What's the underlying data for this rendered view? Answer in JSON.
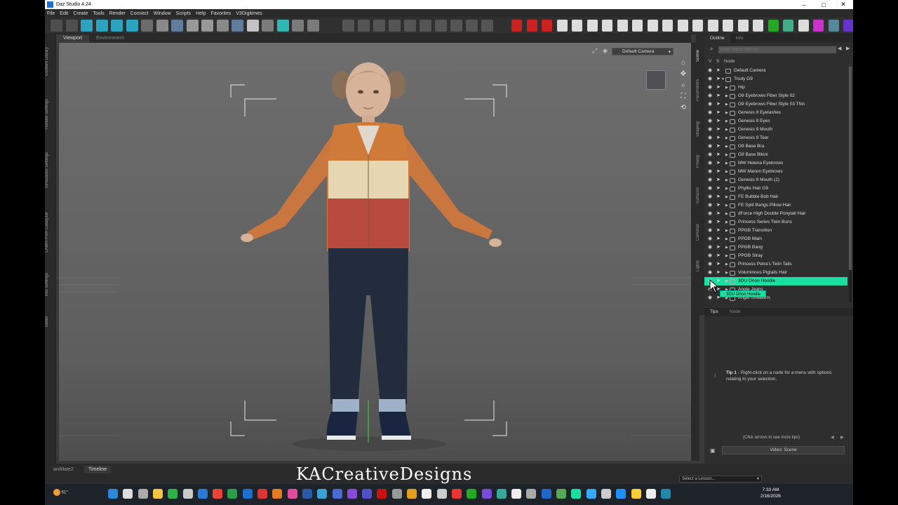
{
  "window": {
    "title": "Daz Studio 4.24"
  },
  "menu": [
    "File",
    "Edit",
    "Create",
    "Tools",
    "Render",
    "Connect",
    "Window",
    "Scripts",
    "Help",
    "Favorites",
    "V3Digitimes"
  ],
  "left_rail_tabs": [
    "Content Library",
    "Render Settings",
    "Simulation Settings",
    "LAMH Prim Catalyzer",
    "Tool Settings",
    "Tablet"
  ],
  "viewport": {
    "tabs": [
      "Viewport",
      "Environment"
    ],
    "active_tab": "Viewport",
    "camera": "Default Camera"
  },
  "side_tabs": [
    "Scene",
    "Parameters",
    "Shaping",
    "Posing",
    "Surfaces",
    "Cameras",
    "Lights"
  ],
  "panel": {
    "tabs": [
      "Outline",
      "Info"
    ],
    "active_tab": "Outline",
    "filter_placeholder": "Enter text to filter by",
    "col_v": "V",
    "col_s": "S",
    "col_node": "Node"
  },
  "tree_nodes": [
    "Default Camera",
    "Trudy G9",
    "Hip",
    "G9 Eyebrows Fiber Style 02",
    "G9 Eyebrows Fiber Style 03 Thin",
    "Genesis 9 Eyelashes",
    "Genesis 9 Eyes",
    "Genesis 9 Mouth",
    "Genesis 9 Tear",
    "G9 Base Bra",
    "G9 Base Bikini",
    "MW Helena Eyebrows",
    "MW Manon Eyebrows",
    "Genesis 9 Mouth (2)",
    "Phyllis Hair G9",
    "FE Bubble Bob Hair",
    "FE Split Bangs Pillow Hair",
    "dForce High Double Ponytail Hair",
    "Princess Series Twin Buns",
    "PPGB Transition",
    "PPGB Main",
    "PPGB Bang",
    "PPGB Stray",
    "Princess Petra's Twin Tails",
    "Voluminous Pigtails Hair",
    "3DU Orion Hoodie",
    "Angie Jeans",
    "Angel Sneakers"
  ],
  "selected_node": "3DU Orion Hoodie",
  "tooltip": "3DU Orion Hoodie",
  "tips": {
    "tabs": [
      "Tips",
      "Node"
    ],
    "tip_title": "Tip 1",
    "tip_text": " - Right-click on a node for a menu with options relating to your selection.",
    "nav_text": "(Click arrows to see more tips)",
    "lesson": "Video: Scene"
  },
  "bottom": {
    "tabs": [
      "aniMate2",
      "Timeline"
    ],
    "active_tab": "Timeline",
    "brand": "KACreativeDesigns",
    "select_lesson": "Select a Lesson..."
  },
  "taskbar": {
    "weather": "61°",
    "time": "7:33 AM",
    "date": "2/16/2026"
  },
  "colors": {
    "highlight": "#19e0a0",
    "accent": "#1a6fd1"
  }
}
